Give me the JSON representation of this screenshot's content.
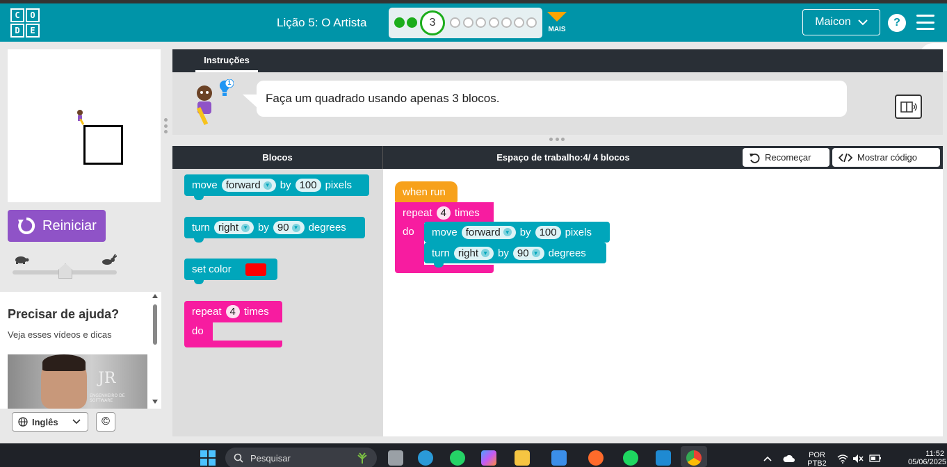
{
  "header": {
    "logo_letters": [
      "C",
      "O",
      "D",
      "E"
    ],
    "lesson_title": "Lição 5: O Artista",
    "current_level": "3",
    "more_label": "MAIS",
    "user_name": "Maicon",
    "help_symbol": "?"
  },
  "left": {
    "reset_label": "Reiniciar",
    "help_title": "Precisar de ajuda?",
    "help_subtitle": "Veja esses vídeos e dicas",
    "video_caption": "JR",
    "video_subcaption": "ENGENHEIRO DE SOFTWARE",
    "language_label": "Inglês",
    "cc_symbol": "©"
  },
  "instructions": {
    "tab_label": "Instruções",
    "text": "Faça um quadrado usando apenas 3 blocos.",
    "hint_count": "1"
  },
  "workspace_bar": {
    "blocks_header": "Blocos",
    "workspace_header": "Espaço de trabalho:4/ 4 blocos",
    "restart_label": "Recomeçar",
    "show_code_label": "Mostrar código"
  },
  "toolbox": {
    "move": {
      "label": "move",
      "dir": "forward",
      "by": "by",
      "amount": "100",
      "unit": "pixels"
    },
    "turn": {
      "label": "turn",
      "dir": "right",
      "by": "by",
      "amount": "90",
      "unit": "degrees"
    },
    "set_color": {
      "label": "set color",
      "color": "#ff0000"
    },
    "repeat": {
      "label": "repeat",
      "count": "4",
      "times": "times",
      "do": "do"
    }
  },
  "program": {
    "when_run": "when run",
    "repeat": {
      "label": "repeat",
      "count": "4",
      "times": "times",
      "do": "do"
    },
    "move": {
      "label": "move",
      "dir": "forward",
      "by": "by",
      "amount": "100",
      "unit": "pixels"
    },
    "turn": {
      "label": "turn",
      "dir": "right",
      "by": "by",
      "amount": "90",
      "unit": "degrees"
    }
  },
  "taskbar": {
    "search_placeholder": "Pesquisar",
    "lang_line1": "POR",
    "lang_line2": "PTB2",
    "time": "11:52",
    "date": "05/06/2025"
  },
  "colors": {
    "header": "#0094a8",
    "reset": "#8f53c7",
    "block_teal": "#00a6bb",
    "block_pink": "#f71ca0",
    "block_orange": "#f7a11b",
    "progress_done": "#1cad1c"
  }
}
